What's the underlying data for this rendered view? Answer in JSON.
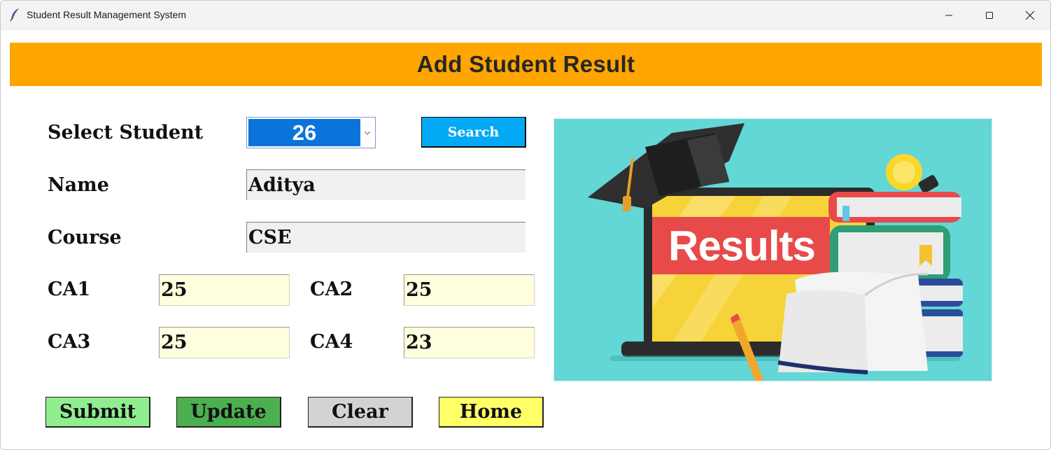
{
  "window": {
    "title": "Student Result Management System"
  },
  "header": {
    "title": "Add Student Result",
    "color": "#ffa500"
  },
  "form": {
    "select_label": "Select Student",
    "selected_student": "26",
    "search_label": "Search",
    "name_label": "Name",
    "name_value": "Aditya",
    "course_label": "Course",
    "course_value": "CSE",
    "ca1_label": "CA1",
    "ca1_value": "25",
    "ca2_label": "CA2",
    "ca2_value": "25",
    "ca3_label": "CA3",
    "ca3_value": "25",
    "ca4_label": "CA4",
    "ca4_value": "23"
  },
  "actions": {
    "submit_label": "Submit",
    "update_label": "Update",
    "clear_label": "Clear",
    "home_label": "Home"
  },
  "image": {
    "banner_text": "Results"
  }
}
